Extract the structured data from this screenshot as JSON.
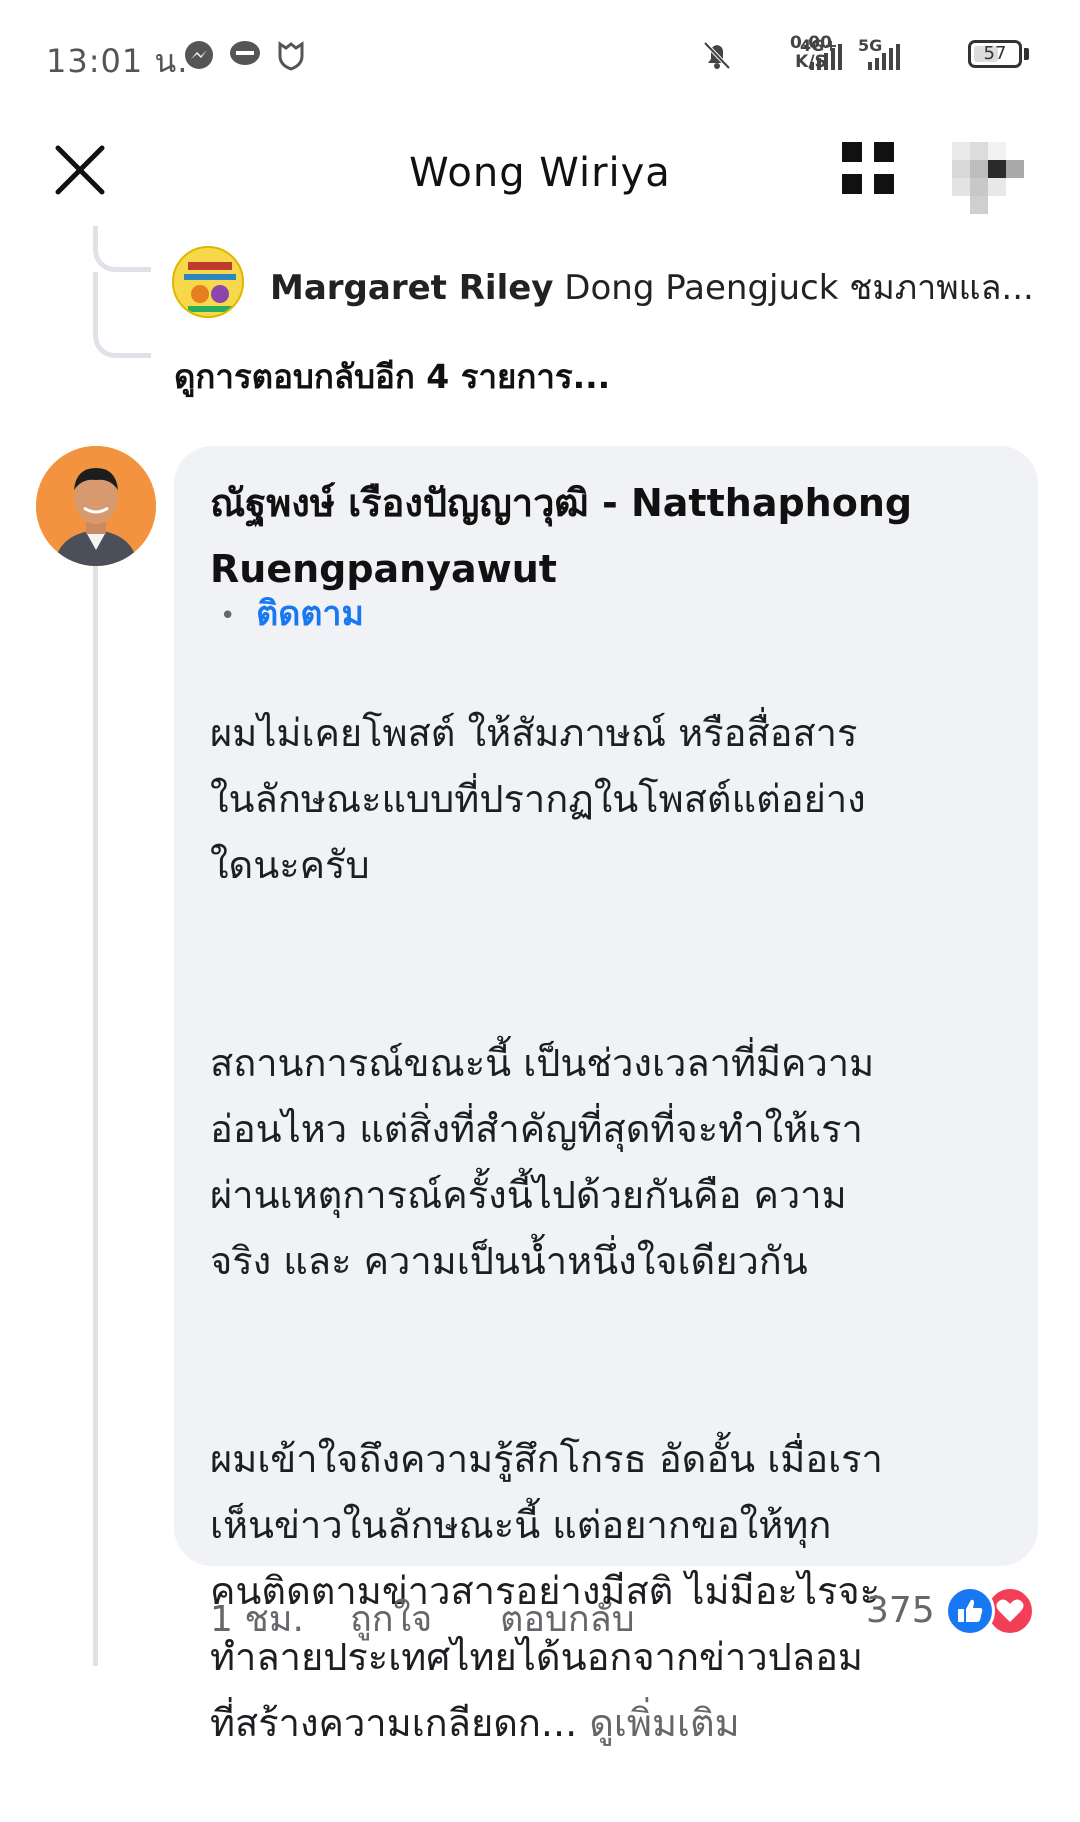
{
  "status_bar": {
    "time": "13:01 น.",
    "speed_value": "0.00",
    "speed_unit": "K/S",
    "net1": "4G+",
    "net2": "5G",
    "battery": "57",
    "battery_level": 0.57
  },
  "header": {
    "title": "Wong Wiriya"
  },
  "thread": {
    "reply_name": "Margaret Riley",
    "reply_text": "Dong Paengjuck ชมภาพแล...",
    "more_replies": "ดูการตอบกลับอีก 4 รายการ..."
  },
  "comment": {
    "author": "ณัฐพงษ์ เรืองปัญญาวุฒิ - Natthaphong Ruengpanyawut",
    "follow": "ติดตาม",
    "paragraph1": "ผมไม่เคยโพสต์ ให้สัมภาษณ์ หรือสื่อสาร\nในลักษณะแบบที่ปรากฏในโพสต์แต่อย่าง\nใดนะครับ",
    "paragraph2": "สถานการณ์ขณะนี้ เป็นช่วงเวลาที่มีความ\nอ่อนไหว แต่สิ่งที่สำคัญที่สุดที่จะทำให้เรา\nผ่านเหตุการณ์ครั้งนี้ไปด้วยกันคือ ความ\nจริง และ ความเป็นน้ำหนึ่งใจเดียวกัน",
    "paragraph3": "ผมเข้าใจถึงความรู้สึกโกรธ อัดอั้น เมื่อเรา\nเห็นข่าวในลักษณะนี้ แต่อยากขอให้ทุก\nคนติดตามข่าวสารอย่างมีสติ ไม่มีอะไรจะ\nทำลายประเทศไทยได้นอกจากข่าวปลอม\nที่สร้างความเกลียดก... ",
    "see_more": "ดูเพิ่มเติม"
  },
  "actions": {
    "time": "1 ชม.",
    "like": "ถูกใจ",
    "reply": "ตอบกลับ",
    "reaction_count": "375",
    "reactions": [
      "like-icon",
      "love-icon"
    ]
  },
  "colors": {
    "accent": "#1877f2",
    "bubble": "#f0f2f5",
    "love": "#f33e58"
  }
}
